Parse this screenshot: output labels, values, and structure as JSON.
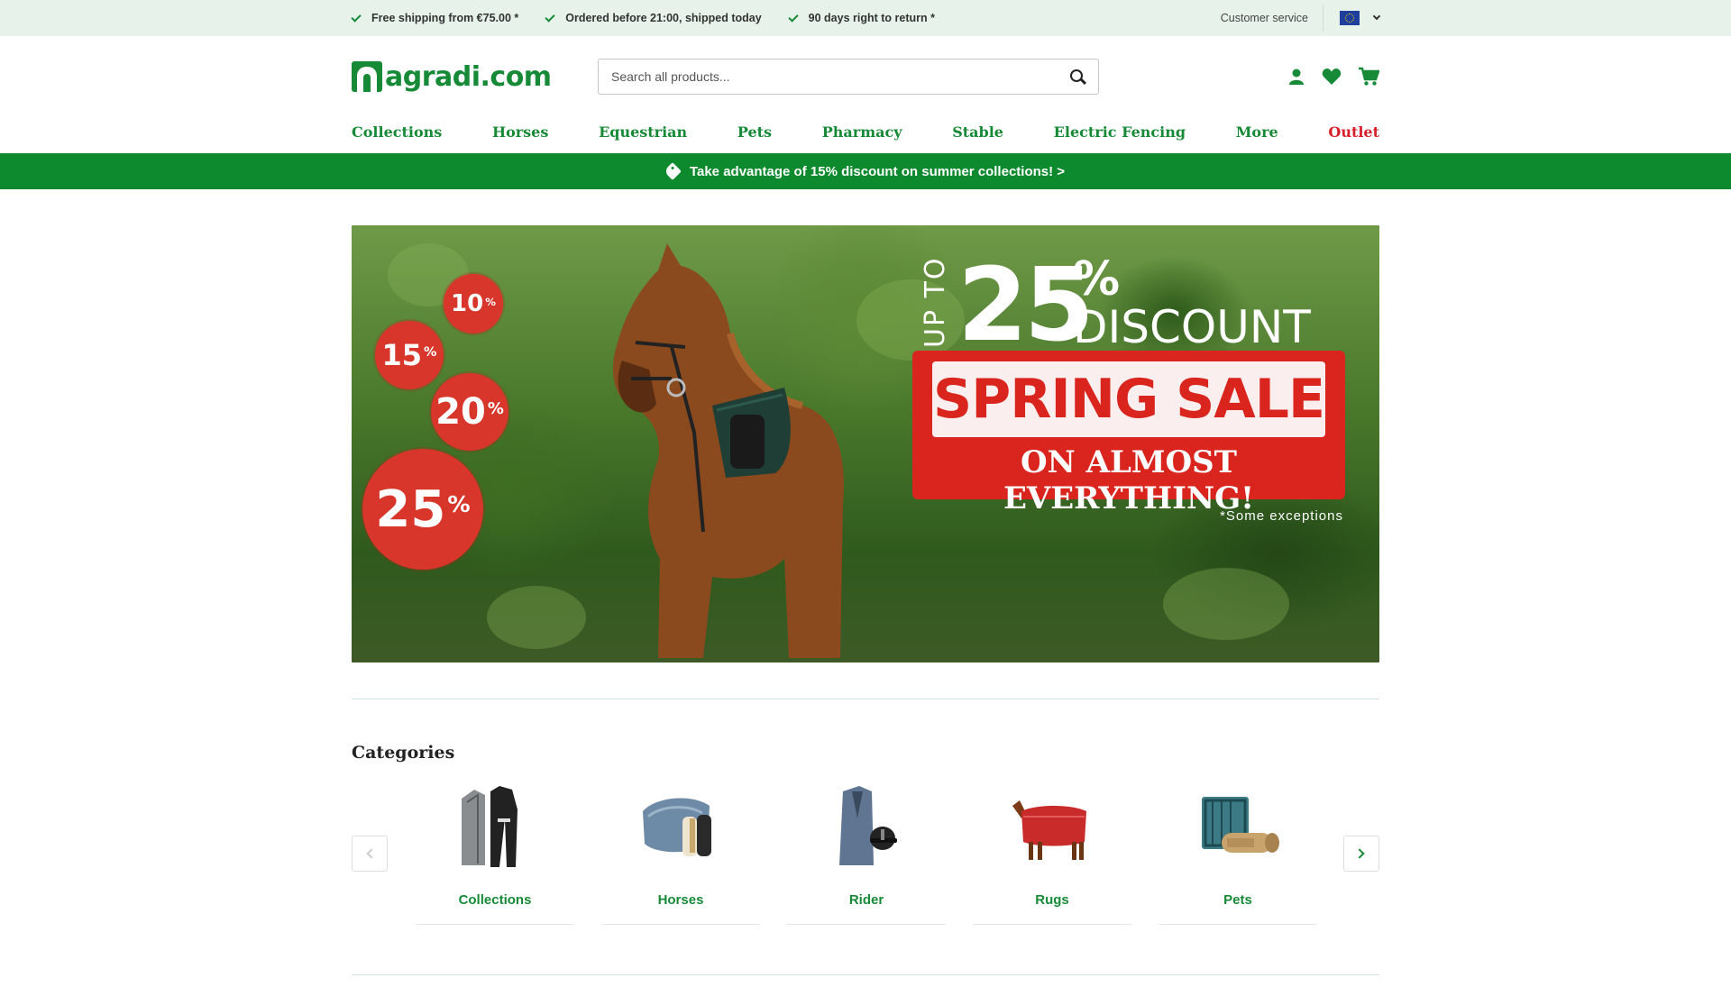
{
  "topbar": {
    "usps": [
      "Free shipping from €75.00 *",
      "Ordered before 21:00, shipped today",
      "90 days right to return *"
    ],
    "customer_service": "Customer service"
  },
  "header": {
    "logo_text": "agradi.com",
    "search_placeholder": "Search all products..."
  },
  "nav": [
    "Collections",
    "Horses",
    "Equestrian",
    "Pets",
    "Pharmacy",
    "Stable",
    "Electric Fencing",
    "More",
    "Outlet"
  ],
  "promo_bar": "Take advantage of 15% discount on summer collections! >",
  "banner": {
    "bubbles": [
      "10",
      "15",
      "20",
      "25"
    ],
    "percent_sign": "%",
    "up_to": "UP TO",
    "big_number": "25",
    "discount": "DISCOUNT",
    "sale": "SPRING SALE",
    "almost": "ON ALMOST EVERYTHING!",
    "exceptions": "*Some exceptions"
  },
  "categories": {
    "title": "Categories",
    "items": [
      "Collections",
      "Horses",
      "Rider",
      "Rugs",
      "Pets"
    ]
  },
  "colors": {
    "brand_green": "#178a37",
    "promo_green": "#0d8a2e",
    "sale_red": "#d9251d",
    "outlet_red": "#d7202b"
  }
}
